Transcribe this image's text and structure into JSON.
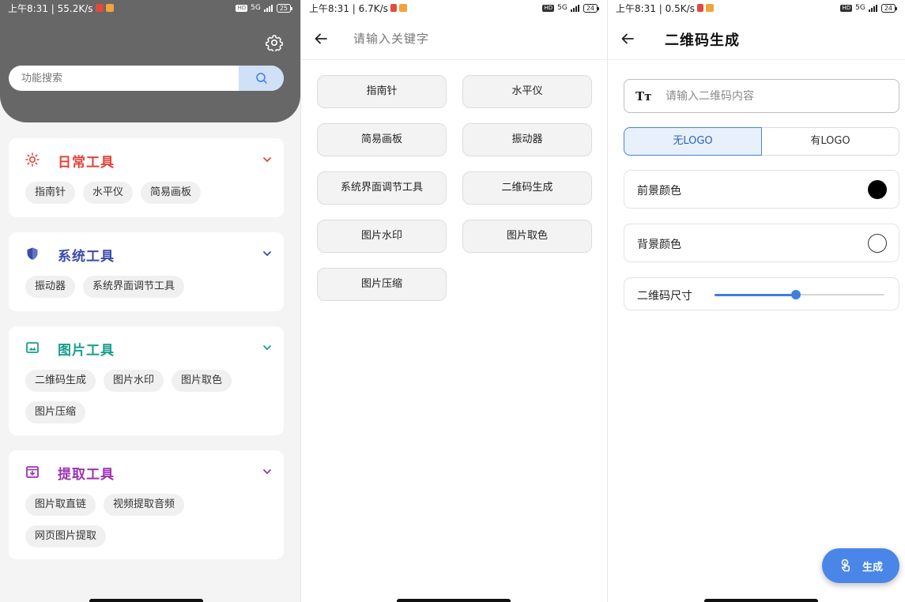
{
  "colors": {
    "header_gray": "#676767",
    "daily": "#e0443e",
    "system": "#3c4ba8",
    "image": "#1a9e8f",
    "extract": "#9c32b0",
    "accent_blue": "#4a86e8"
  },
  "screens": [
    {
      "status": {
        "time": "上午8:31 | 55.2K/s",
        "hd": "HD",
        "net": "5G",
        "battery": "25"
      },
      "settings_icon": "gear-icon",
      "search": {
        "placeholder": "功能搜索",
        "button_icon": "search-icon"
      },
      "categories": [
        {
          "title": "日常工具",
          "icon": "sun-icon",
          "color": "#e0443e",
          "items": [
            "指南针",
            "水平仪",
            "简易画板"
          ]
        },
        {
          "title": "系统工具",
          "icon": "shield-icon",
          "color": "#3c4ba8",
          "items": [
            "振动器",
            "系统界面调节工具"
          ]
        },
        {
          "title": "图片工具",
          "icon": "image-icon",
          "color": "#1a9e8f",
          "items": [
            "二维码生成",
            "图片水印",
            "图片取色",
            "图片压缩"
          ]
        },
        {
          "title": "提取工具",
          "icon": "download-box-icon",
          "color": "#9c32b0",
          "items": [
            "图片取直链",
            "视频提取音频",
            "网页图片提取"
          ]
        }
      ]
    },
    {
      "status": {
        "time": "上午8:31 | 6.7K/s",
        "hd": "HD",
        "net": "5G",
        "battery": "24"
      },
      "search_placeholder": "请输入关键字",
      "results": [
        "指南针",
        "水平仪",
        "简易画板",
        "振动器",
        "系统界面调节工具",
        "二维码生成",
        "图片水印",
        "图片取色",
        "图片压缩"
      ]
    },
    {
      "status": {
        "time": "上午8:31 | 0.5K/s",
        "hd": "HD",
        "net": "5G",
        "battery": "24"
      },
      "title": "二维码生成",
      "input_icon": "Tт",
      "input_placeholder": "请输入二维码内容",
      "logo_options": [
        "无LOGO",
        "有LOGO"
      ],
      "selected_logo_option": "无LOGO",
      "foreground_label": "前景颜色",
      "foreground_color": "#000000",
      "background_label": "背景颜色",
      "background_color": "#ffffff",
      "size_label": "二维码尺寸",
      "size_level": 0.48,
      "fab_label": "生成"
    }
  ]
}
